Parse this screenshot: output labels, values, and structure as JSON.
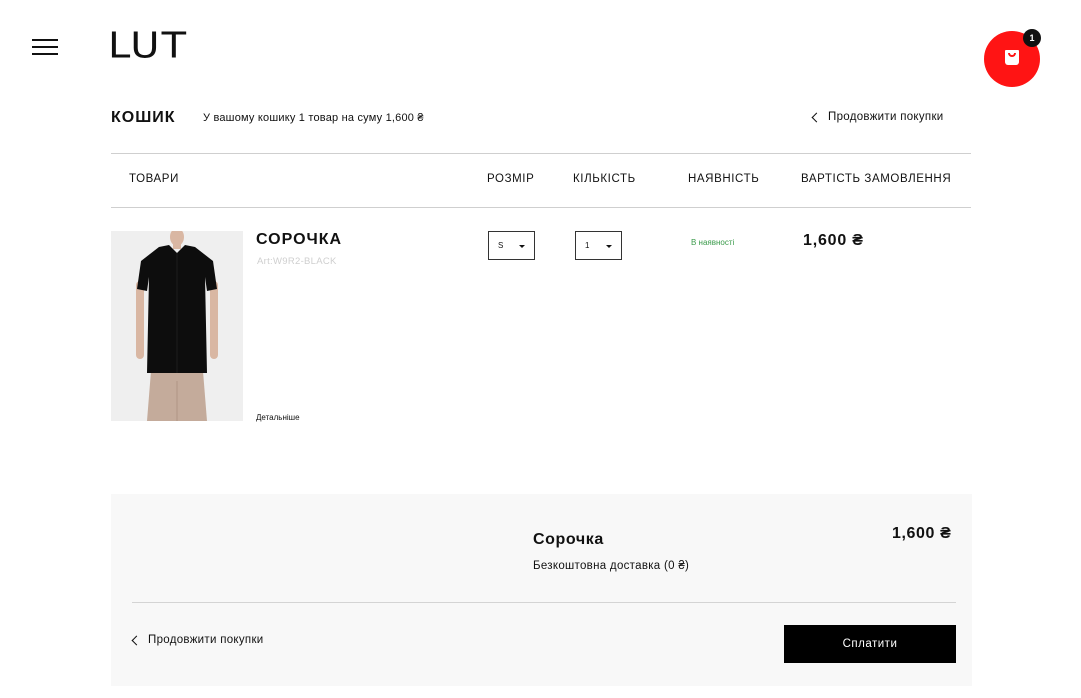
{
  "header": {
    "logo": "LUT",
    "cart_count": "1"
  },
  "cart": {
    "title": "КОШИК",
    "summary": "У вашому кошику 1 товар на суму 1,600 ₴",
    "continue_label": "Продовжити покупки"
  },
  "table": {
    "headers": {
      "items": "ТОВАРИ",
      "size": "РОЗМІР",
      "quantity": "КІЛЬКІСТЬ",
      "availability": "НАЯВНІСТЬ",
      "total": "ВАРТІСТЬ ЗАМОВЛЕННЯ"
    }
  },
  "product": {
    "name": "СОРОЧКА",
    "article": "Art:W9R2-BLACK",
    "details_link": "Детальніше",
    "size": "S",
    "quantity": "1",
    "availability": "В наявності",
    "price": "1,600 ₴"
  },
  "summary": {
    "product_name": "Сорочка",
    "price": "1,600 ₴",
    "delivery": "Безкоштовна доставка (0  ₴)",
    "continue_label": "Продовжити покупки",
    "pay_button": "Сплатити"
  },
  "colors": {
    "accent_red": "#ff1414",
    "in_stock_green": "#3b9b4b",
    "button_black": "#000000"
  }
}
